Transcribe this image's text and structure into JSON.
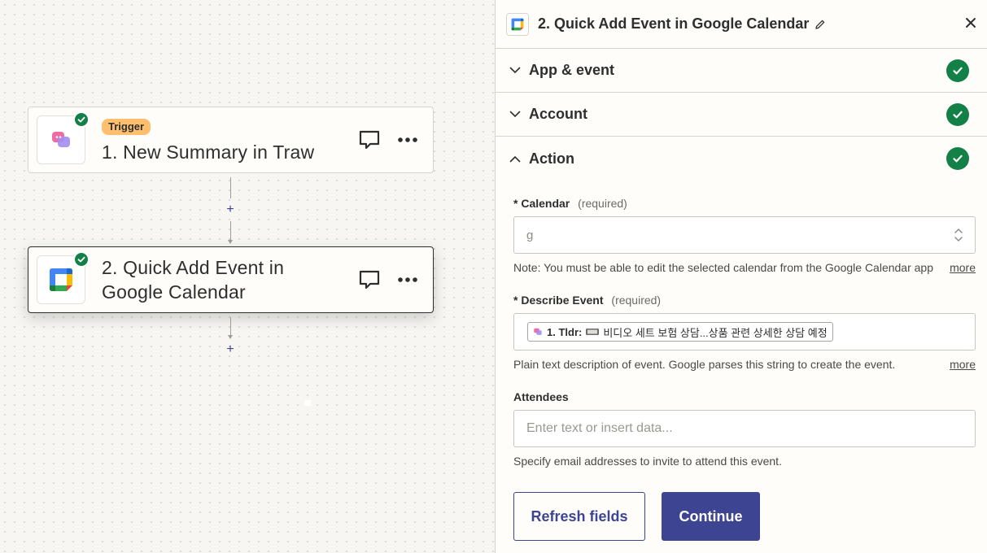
{
  "canvas": {
    "trigger_step": {
      "badge": "Trigger",
      "title": "1. New Summary in Traw",
      "app_icon": "traw-logo",
      "status_icon": "check-icon"
    },
    "action_step": {
      "title_line1": "2. Quick Add Event in",
      "title_line2": "Google Calendar",
      "app_icon": "google-calendar-logo",
      "status_icon": "check-icon"
    },
    "add_step_label": "+"
  },
  "panel": {
    "title": "2. Quick Add Event in Google Calendar",
    "sections": [
      {
        "label": "App & event"
      },
      {
        "label": "Account"
      },
      {
        "label": "Action"
      }
    ],
    "fields": {
      "calendar": {
        "asterisk": "*",
        "label": "Calendar",
        "required": "(required)",
        "value": "g",
        "help": "Note: You must be able to edit the selected calendar from the Google Calendar app",
        "more": "more"
      },
      "describe_event": {
        "asterisk": "*",
        "label": "Describe Event",
        "required": "(required)",
        "chip_bold": "1. Tldr:",
        "chip_text": "비디오 세트 보험 상담...상품 관련 상세한 상담 예정",
        "help": "Plain text description of event. Google parses this string to create the event.",
        "more": "more"
      },
      "attendees": {
        "label": "Attendees",
        "placeholder": "Enter text or insert data...",
        "help": "Specify email addresses to invite to attend this event."
      }
    },
    "buttons": {
      "refresh": "Refresh fields",
      "continue": "Continue"
    }
  },
  "colors": {
    "accent": "#3d4592",
    "success": "#128047",
    "trigger_badge": "#ffbf6e"
  }
}
